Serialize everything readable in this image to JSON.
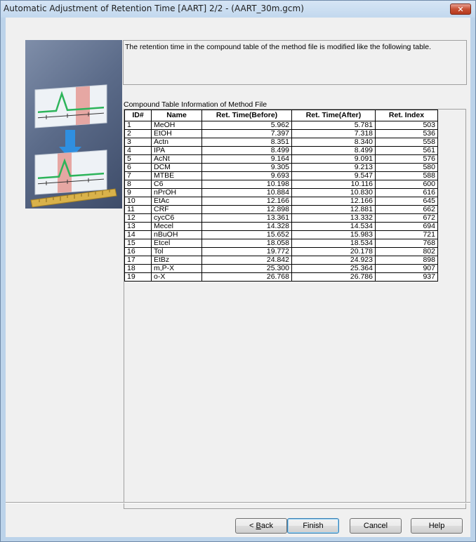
{
  "window": {
    "title": "Automatic Adjustment of Retention Time [AART] 2/2 - (AART_30m.gcm)",
    "close_glyph": "✕"
  },
  "description": "The retention time in the compound table of the method file is modified like the following table.",
  "table": {
    "caption": "Compound Table Information of Method File",
    "columns": [
      "ID#",
      "Name",
      "Ret. Time(Before)",
      "Ret. Time(After)",
      "Ret. Index"
    ],
    "rows": [
      [
        "1",
        "MeOH",
        "5.962",
        "5.781",
        "503"
      ],
      [
        "2",
        "EtOH",
        "7.397",
        "7.318",
        "536"
      ],
      [
        "3",
        "Actn",
        "8.351",
        "8.340",
        "558"
      ],
      [
        "4",
        "IPA",
        "8.499",
        "8.499",
        "561"
      ],
      [
        "5",
        "AcNt",
        "9.164",
        "9.091",
        "576"
      ],
      [
        "6",
        "DCM",
        "9.305",
        "9.213",
        "580"
      ],
      [
        "7",
        "MTBE",
        "9.693",
        "9.547",
        "588"
      ],
      [
        "8",
        "C6",
        "10.198",
        "10.116",
        "600"
      ],
      [
        "9",
        "nPrOH",
        "10.884",
        "10.830",
        "616"
      ],
      [
        "10",
        "EtAc",
        "12.166",
        "12.166",
        "645"
      ],
      [
        "11",
        "CRF",
        "12.898",
        "12.881",
        "662"
      ],
      [
        "12",
        "cycC6",
        "13.361",
        "13.332",
        "672"
      ],
      [
        "13",
        "Mecel",
        "14.328",
        "14.534",
        "694"
      ],
      [
        "14",
        "nBuOH",
        "15.652",
        "15.983",
        "721"
      ],
      [
        "15",
        "Etcel",
        "18.058",
        "18.534",
        "768"
      ],
      [
        "16",
        "Tol",
        "19.772",
        "20.178",
        "802"
      ],
      [
        "17",
        "EtBz",
        "24.842",
        "24.923",
        "898"
      ],
      [
        "18",
        "m,P-X",
        "25.300",
        "25.364",
        "907"
      ],
      [
        "19",
        "o-X",
        "26.768",
        "26.786",
        "937"
      ]
    ]
  },
  "buttons": {
    "back_prefix": "< ",
    "back_mnemonic": "B",
    "back_rest": "ack",
    "finish": "Finish",
    "cancel": "Cancel",
    "help": "Help"
  },
  "colors": {
    "title_bar": "#c2d8ee",
    "dialog_bg": "#f0f0f0",
    "graphic_bg": "#5b6b89",
    "peak_line": "#2db45a",
    "highlight_band": "#e49a94",
    "arrow": "#2f8fe0",
    "ruler": "#d9b24a"
  },
  "icons": {
    "wizard_graphic": "retention-time-shift-illustration",
    "close": "close-icon"
  }
}
